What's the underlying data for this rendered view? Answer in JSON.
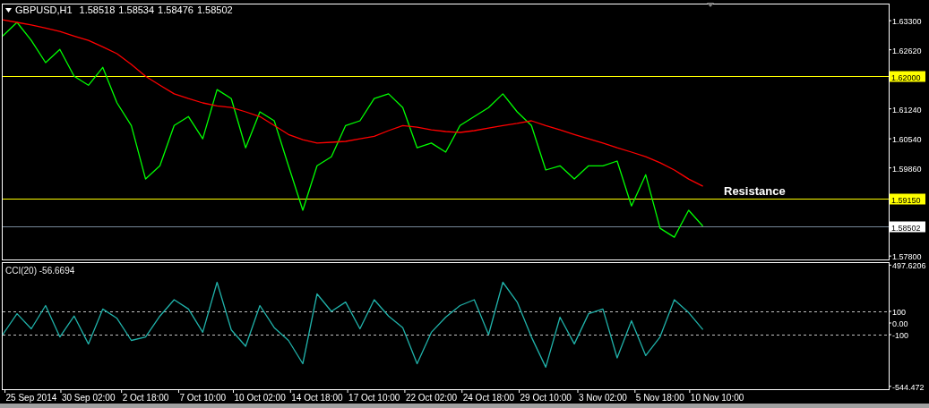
{
  "header": {
    "title": "GBPUSD,H1",
    "quotes": [
      "1.58518",
      "1.58534",
      "1.58476",
      "1.58502"
    ]
  },
  "price_chart": {
    "chart_data": {
      "type": "line",
      "categories": [
        null,
        null,
        null,
        null,
        null,
        null,
        null,
        null,
        null,
        null,
        null,
        null,
        null,
        null,
        null,
        null,
        null,
        null,
        null,
        null,
        null,
        null,
        null,
        null,
        null,
        null,
        null,
        null,
        null,
        null,
        null,
        null,
        null,
        null,
        null,
        null,
        null,
        null,
        null,
        null,
        null,
        null,
        null,
        null,
        null,
        null,
        null,
        null,
        null,
        null,
        null,
        null,
        null,
        null,
        null,
        null,
        null,
        null,
        null,
        null,
        null,
        null
      ],
      "series": [
        {
          "color": "#00ff00",
          "values": [
            1.6294,
            1.6326,
            1.6284,
            1.6232,
            1.6263,
            1.62,
            1.6179,
            1.6221,
            1.6138,
            1.6085,
            1.596,
            1.5991,
            1.6085,
            1.6106,
            1.6054,
            1.6169,
            1.6148,
            1.6033,
            1.6117,
            1.6096,
            1.5991,
            1.5887,
            1.5991,
            1.6012,
            1.6085,
            1.6096,
            1.6148,
            1.6159,
            1.6127,
            1.6033,
            1.6044,
            1.6023,
            1.6085,
            1.6106,
            1.6127,
            1.6159,
            1.6117,
            1.6085,
            1.5981,
            1.5991,
            1.596,
            1.5991,
            1.5991,
            1.6002,
            1.5897,
            1.597,
            1.5845,
            1.5824,
            1.5887,
            1.585,
            null,
            null,
            null,
            null,
            null,
            null,
            null,
            null,
            null,
            null,
            null,
            null
          ]
        },
        {
          "color": "#ff0000",
          "values": [
            1.6332,
            1.6326,
            1.632,
            1.6313,
            1.6305,
            1.6294,
            1.6284,
            1.6269,
            1.6253,
            1.6228,
            1.62,
            1.6179,
            1.6159,
            1.6148,
            1.6138,
            1.6131,
            1.6127,
            1.6117,
            1.6106,
            1.6085,
            1.6064,
            1.6052,
            1.6044,
            1.6046,
            1.6048,
            1.6054,
            1.606,
            1.6073,
            1.6085,
            1.6081,
            1.6075,
            1.6071,
            1.6069,
            1.6073,
            1.6079,
            1.6085,
            1.609,
            1.6096,
            1.6085,
            1.6075,
            1.6064,
            1.6054,
            1.6044,
            1.6033,
            1.6023,
            1.6012,
            1.5998,
            1.5981,
            1.596,
            1.5943,
            null,
            null,
            null,
            null,
            null,
            null,
            null,
            null,
            null,
            null,
            null,
            null
          ]
        }
      ],
      "ylim": [
        1.5772,
        1.637
      ],
      "yticks": [
        {
          "value": 1.633,
          "label": "1.63300"
        },
        {
          "value": 1.6262,
          "label": "1.62620"
        },
        {
          "value": 1.6124,
          "label": "1.61240"
        },
        {
          "value": 1.6054,
          "label": "1.60540"
        },
        {
          "value": 1.5986,
          "label": "1.59860"
        },
        {
          "value": 1.578,
          "label": "1.57800"
        }
      ],
      "ref_lines": [
        {
          "axis": "y",
          "value": 1.62,
          "color": "#ffff00",
          "label": "1.62000"
        },
        {
          "axis": "y",
          "value": 1.5915,
          "color": "#ffff00",
          "label": "1.59150"
        },
        {
          "axis": "y",
          "value": 1.58502,
          "color": "#778899",
          "label": "1.58502"
        }
      ],
      "annotations": [
        "Resistance"
      ]
    }
  },
  "indicator": {
    "label": "CCI(20) -56.6694",
    "chart_data": {
      "type": "line",
      "categories": [
        null,
        null,
        "25 Sep 2014",
        null,
        null,
        null,
        "30 Sep 02:00",
        null,
        null,
        null,
        "2 Oct 18:00",
        null,
        null,
        null,
        "7 Oct 10:00",
        null,
        null,
        null,
        "10 Oct 02:00",
        null,
        null,
        null,
        "14 Oct 18:00",
        null,
        null,
        null,
        "17 Oct 10:00",
        null,
        null,
        null,
        "22 Oct 02:00",
        null,
        null,
        null,
        "24 Oct 18:00",
        null,
        null,
        null,
        "29 Oct 10:00",
        null,
        null,
        null,
        "3 Nov 02:00",
        null,
        null,
        null,
        "5 Nov 18:00",
        null,
        null,
        null,
        "10 Nov 10:00",
        null,
        null,
        null,
        null,
        null,
        null,
        null,
        null,
        null,
        null,
        null
      ],
      "series": [
        {
          "color": "#20b2aa",
          "values": [
            -100,
            80,
            -50,
            150,
            -120,
            60,
            -180,
            120,
            40,
            -150,
            -120,
            60,
            200,
            120,
            -80,
            350,
            -60,
            -200,
            150,
            -40,
            -150,
            -350,
            250,
            100,
            180,
            -50,
            200,
            60,
            -40,
            -350,
            -80,
            50,
            150,
            200,
            -100,
            350,
            180,
            -120,
            -380,
            50,
            -180,
            80,
            120,
            -300,
            20,
            -280,
            -120,
            200,
            90,
            -57,
            null,
            null,
            null,
            null,
            null,
            null,
            null,
            null,
            null,
            null,
            null,
            null
          ]
        }
      ],
      "ylim": [
        -569,
        523
      ],
      "yticks": [
        {
          "value": 497.6206,
          "label": "497.6206"
        },
        {
          "value": 100,
          "label": "100"
        },
        {
          "value": 0,
          "label": "0.00"
        },
        {
          "value": -100,
          "label": "-100"
        },
        {
          "value": -544.472,
          "label": "-544.472"
        }
      ],
      "ref_lines": [
        {
          "axis": "y",
          "value": 100
        },
        {
          "axis": "y",
          "value": -100
        }
      ]
    }
  }
}
